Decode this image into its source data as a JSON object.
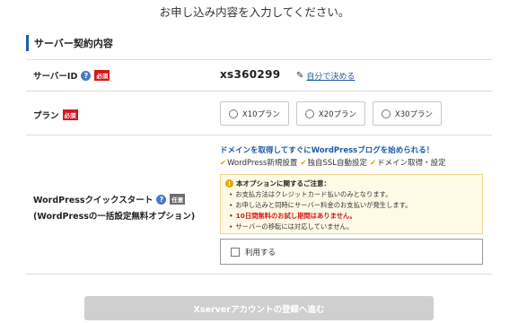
{
  "page": {
    "instruction": "お申し込み内容を入力してください。"
  },
  "section": {
    "title": "サーバー契約内容"
  },
  "server_id": {
    "label": "サーバーID",
    "required_badge": "必須",
    "help_icon": "question-circle-icon",
    "value": "xs360299",
    "self_decide_icon": "pencil-icon",
    "self_decide_link": "自分で決める"
  },
  "plan": {
    "label": "プラン",
    "required_badge": "必須",
    "options": [
      "X10プラン",
      "X20プラン",
      "X30プラン"
    ]
  },
  "quickstart": {
    "label_line1": "WordPressクイックスタート",
    "label_line2": "(WordPressの一括設定無料オプション)",
    "optional_badge": "任意",
    "help_icon": "question-circle-icon",
    "promo_heading": "ドメインを取得してすぐにWordPressブログを始められる！",
    "features": [
      "WordPress新規設置",
      "独自SSL自動設定",
      "ドメイン取得・設定"
    ],
    "notice": {
      "icon": "warning-icon",
      "title": "本オプションに関するご注意：",
      "items": [
        "お支払方法はクレジットカード払いのみとなります。",
        "お申し込みと同時にサーバー料金のお支払いが発生します。",
        "10日間無料のお試し期間はありません。",
        "サーバーの移転には対応していません。"
      ],
      "highlight_index": 2
    },
    "use_checkbox_label": "利用する"
  },
  "submit": {
    "label": "Xserverアカウントの登録へ進む"
  },
  "colors": {
    "accent": "#1e5aa8",
    "required": "#d11a1a",
    "check": "#e5a200",
    "notice_bg": "#fffae6",
    "submit_disabled": "#cfcfcf"
  }
}
